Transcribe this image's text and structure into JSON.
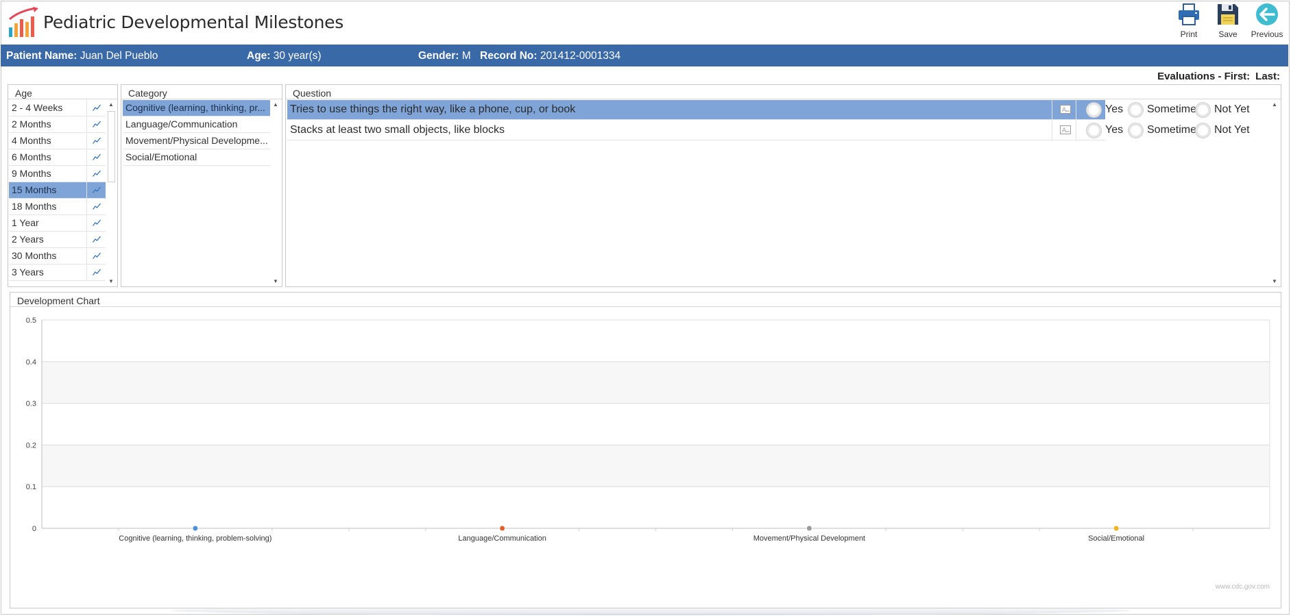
{
  "app": {
    "title": "Pediatric Developmental Milestones"
  },
  "toolbar": {
    "print_label": "Print",
    "save_label": "Save",
    "previous_label": "Previous"
  },
  "patient": {
    "name_label": "Patient Name:",
    "name": "Juan Del Pueblo",
    "age_label": "Age:",
    "age": "30 year(s)",
    "gender_label": "Gender:",
    "gender": "M",
    "record_label": "Record No:",
    "record": "201412-0001334"
  },
  "evaluations": {
    "label": "Evaluations - First:",
    "last_label": "Last:"
  },
  "age_panel": {
    "header": "Age",
    "selected_index": 5,
    "items": [
      "2 - 4 Weeks",
      "2 Months",
      "4 Months",
      "6 Months",
      "9 Months",
      "15 Months",
      "18 Months",
      "1 Year",
      "2 Years",
      "30 Months",
      "3 Years"
    ]
  },
  "category_panel": {
    "header": "Category",
    "selected_index": 0,
    "items": [
      "Cognitive (learning, thinking, pr...",
      "Language/Communication",
      "Movement/Physical Developme...",
      "Social/Emotional"
    ]
  },
  "question_panel": {
    "header": "Question",
    "options": [
      "Yes",
      "Sometimes",
      "Not Yet"
    ],
    "questions": [
      {
        "text": "Tries to use things the right way, like a phone, cup, or book",
        "selected": true
      },
      {
        "text": "Stacks at least two small objects, like blocks",
        "selected": false
      }
    ]
  },
  "chart_panel": {
    "header": "Development Chart",
    "watermark": "www.cdc.gov.com"
  },
  "chart_data": {
    "type": "scatter",
    "title": "",
    "xlabel": "",
    "ylabel": "",
    "categories": [
      "Cognitive (learning, thinking, problem-solving)",
      "Language/Communication",
      "Movement/Physical Development",
      "Social/Emotional"
    ],
    "values": [
      0,
      0,
      0,
      0
    ],
    "point_colors": [
      "#4a90d9",
      "#e0602a",
      "#9a9a9a",
      "#f2b51c"
    ],
    "ylim": [
      0,
      0.5
    ],
    "yticks": [
      "0",
      "0.1",
      "0.2",
      "0.3",
      "0.4",
      "0.5"
    ],
    "grid": true,
    "band_colors": [
      "#ffffff",
      "#f7f7f7"
    ]
  },
  "colors": {
    "accent": "#3a69a8",
    "selection": "#7ea4d8"
  }
}
